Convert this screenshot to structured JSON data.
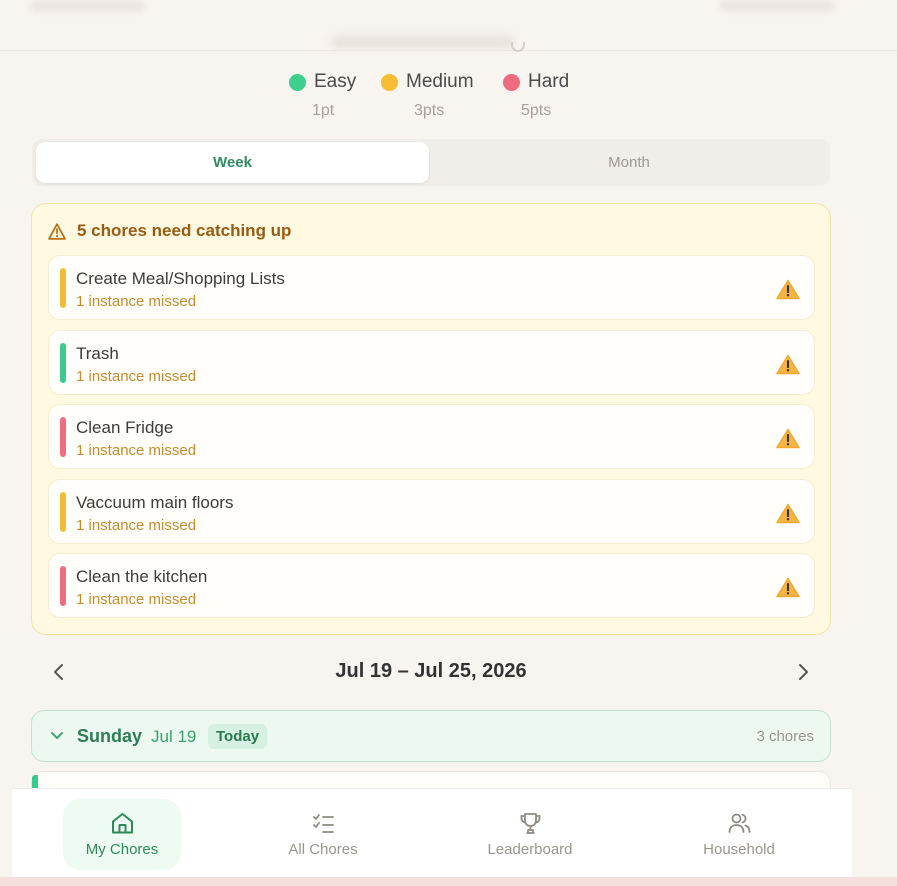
{
  "difficulty_legend": [
    {
      "label": "Easy",
      "points": "1pt",
      "color": "#3ccf8e"
    },
    {
      "label": "Medium",
      "points": "3pts",
      "color": "#f5bd31"
    },
    {
      "label": "Hard",
      "points": "5pts",
      "color": "#ef6b7f"
    }
  ],
  "view_toggle": {
    "week": "Week",
    "month": "Month",
    "selected": "Week"
  },
  "catching_up": {
    "title": "5 chores need catching up",
    "icon": "warning-triangle-icon",
    "chores": [
      {
        "name": "Create Meal/Shopping Lists",
        "status": "1 instance missed",
        "difficulty": "Medium",
        "color": "#f0bd35",
        "icon": "warning-icon"
      },
      {
        "name": "Trash",
        "status": "1 instance missed",
        "difficulty": "Easy",
        "color": "#3fca8d",
        "icon": "warning-icon"
      },
      {
        "name": "Clean Fridge",
        "status": "1 instance missed",
        "difficulty": "Hard",
        "color": "#ee6d80",
        "icon": "warning-icon"
      },
      {
        "name": "Vaccuum main floors",
        "status": "1 instance missed",
        "difficulty": "Medium",
        "color": "#f0bd35",
        "icon": "warning-icon"
      },
      {
        "name": "Clean the kitchen",
        "status": "1 instance missed",
        "difficulty": "Hard",
        "color": "#ee6d80",
        "icon": "warning-icon"
      }
    ]
  },
  "week_navigation": {
    "range": "Jul 19 – Jul 25, 2026"
  },
  "day": {
    "name": "Sunday",
    "date": "Jul 19",
    "badge": "Today",
    "count": "3 chores"
  },
  "bottom_nav": [
    {
      "label": "My Chores",
      "icon": "home-icon",
      "active": true
    },
    {
      "label": "All Chores",
      "icon": "checklist-icon",
      "active": false
    },
    {
      "label": "Leaderboard",
      "icon": "trophy-icon",
      "active": false
    },
    {
      "label": "Household",
      "icon": "users-icon",
      "active": false
    }
  ],
  "colors": {
    "accent_green": "#2d8a58",
    "background": "#f8f4ef",
    "warning_panel": "#fff9e1",
    "warning_text": "#9a5a12"
  }
}
